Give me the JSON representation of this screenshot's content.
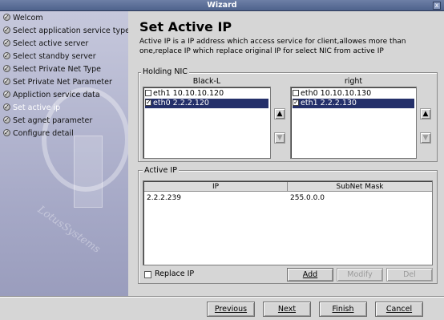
{
  "window": {
    "title": "Wizard",
    "close_glyph": "x"
  },
  "sidebar": {
    "watermark_text": "LotusSystems",
    "steps": [
      {
        "label": "Welcom",
        "current": false
      },
      {
        "label": "Select application service type",
        "current": false
      },
      {
        "label": "Select active server",
        "current": false
      },
      {
        "label": "Select standby server",
        "current": false
      },
      {
        "label": "Select Private Net Type",
        "current": false
      },
      {
        "label": "Set Private Net Parameter",
        "current": false
      },
      {
        "label": "Appliction service data",
        "current": false
      },
      {
        "label": "Set active ip",
        "current": true
      },
      {
        "label": "Set agnet parameter",
        "current": false
      },
      {
        "label": "Configure detail",
        "current": false
      }
    ]
  },
  "page": {
    "title": "Set Active IP",
    "description": "Active IP is a IP address which access service for client,allowes more than one,replace IP which replace original IP for select NIC from active IP"
  },
  "holding_nic": {
    "label": "Holding NIC",
    "left": {
      "header": "Black-L",
      "items": [
        {
          "label": "eth1 10.10.10.120",
          "checked": false,
          "selected": false
        },
        {
          "label": "eth0 2.2.2.120",
          "checked": true,
          "selected": true
        }
      ]
    },
    "right": {
      "header": "right",
      "items": [
        {
          "label": "eth0 10.10.10.130",
          "checked": false,
          "selected": false
        },
        {
          "label": "eth1 2.2.2.130",
          "checked": true,
          "selected": true
        }
      ]
    },
    "buttons": {
      "up_icon": "arrow-up-icon",
      "down_icon": "arrow-down-icon"
    }
  },
  "active_ip": {
    "label": "Active IP",
    "columns": [
      "IP",
      "SubNet Mask"
    ],
    "rows": [
      {
        "ip": "2.2.2.239",
        "mask": "255.0.0.0"
      }
    ],
    "replace_ip_label": "Replace IP",
    "replace_ip_checked": false,
    "add_label": "Add",
    "modify_label": "Modify",
    "del_label": "Del"
  },
  "footer": {
    "previous_label": "Previous",
    "next_label": "Next",
    "finish_label": "Finish",
    "cancel_label": "Cancel"
  },
  "colors": {
    "selection": "#24306a",
    "sidebar_top": "#c6c8dc",
    "sidebar_bottom": "#9a9dbd",
    "titlebar": "#5a6d96"
  }
}
